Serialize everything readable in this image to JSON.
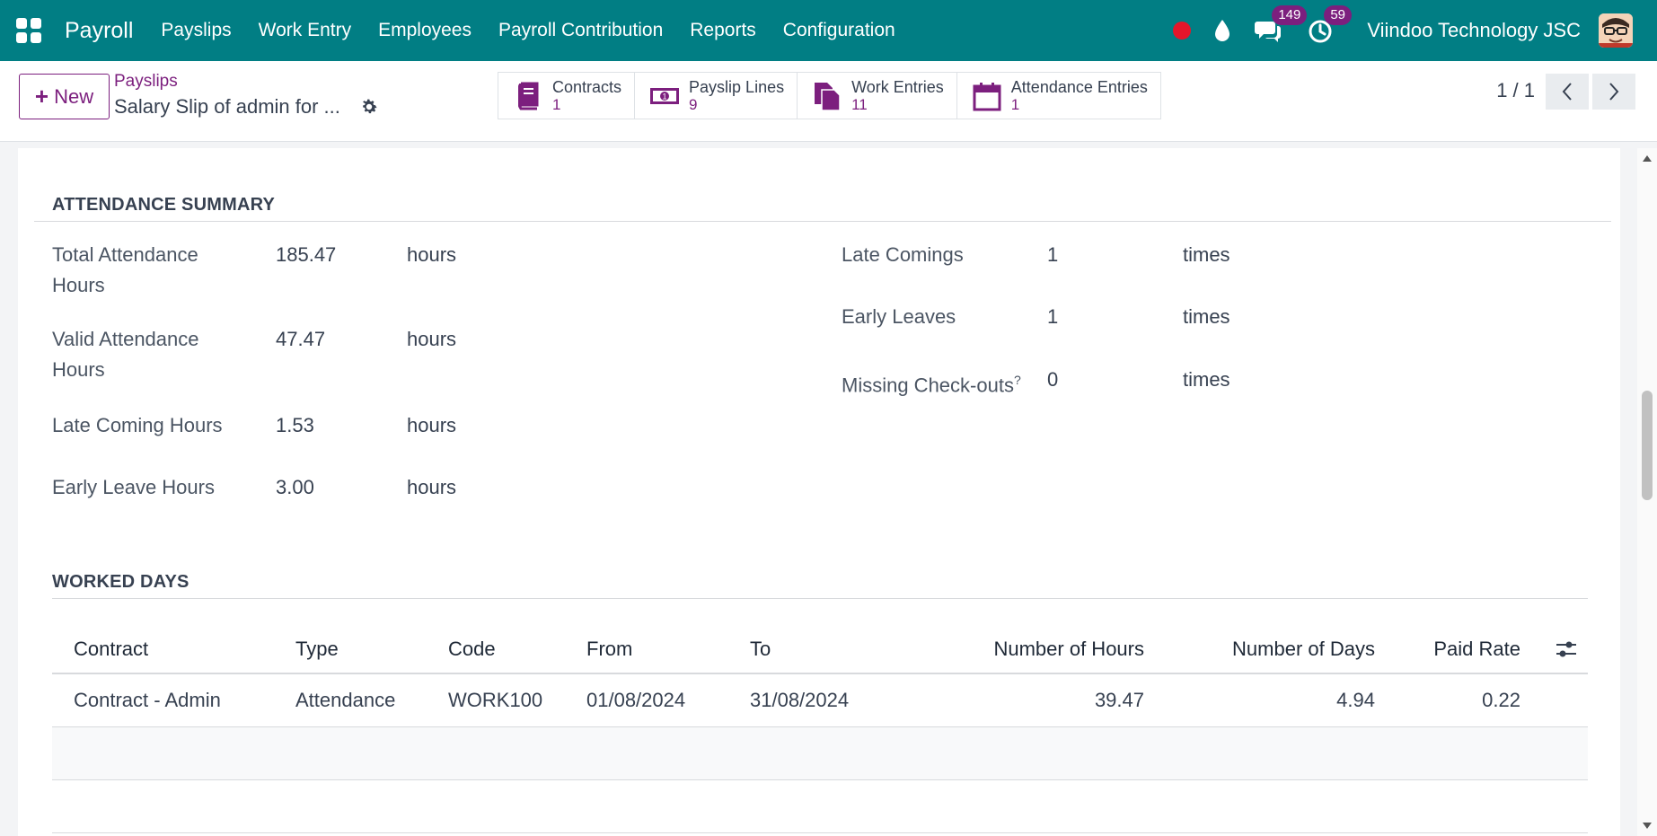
{
  "navbar": {
    "app_name": "Payroll",
    "menu": [
      "Payslips",
      "Work Entry",
      "Employees",
      "Payroll Contribution",
      "Reports",
      "Configuration"
    ],
    "messages_count": "149",
    "activities_count": "59",
    "company": "Viindoo Technology JSC",
    "colors": {
      "bar": "#017e84",
      "badge": "#7c1f7e",
      "recording": "#e4162a"
    }
  },
  "control": {
    "new_label": "New",
    "breadcrumb": "Payslips",
    "title": "Salary Slip of admin for ...",
    "smart_buttons": [
      {
        "label": "Contracts",
        "value": "1",
        "icon": "book-icon"
      },
      {
        "label": "Payslip Lines",
        "value": "9",
        "icon": "money-icon"
      },
      {
        "label": "Work Entries",
        "value": "11",
        "icon": "files-icon"
      },
      {
        "label": "Attendance Entries",
        "value": "1",
        "icon": "calendar-icon"
      }
    ],
    "pager": "1 / 1"
  },
  "attendance": {
    "section_title": "ATTENDANCE SUMMARY",
    "left": [
      {
        "label_1": "Total Attendance",
        "label_2": "Hours",
        "value": "185.47",
        "unit": "hours"
      },
      {
        "label_1": "Valid Attendance",
        "label_2": "Hours",
        "value": "47.47",
        "unit": "hours"
      },
      {
        "label_1": "Late Coming Hours",
        "label_2": "",
        "value": "1.53",
        "unit": "hours"
      },
      {
        "label_1": "Early Leave Hours",
        "label_2": "",
        "value": "3.00",
        "unit": "hours"
      }
    ],
    "right": [
      {
        "label": "Late Comings",
        "value": "1",
        "unit": "times"
      },
      {
        "label": "Early Leaves",
        "value": "1",
        "unit": "times"
      },
      {
        "label": "Missing Check-outs",
        "help": "?",
        "value": "0",
        "unit": "times"
      }
    ]
  },
  "worked_days": {
    "section_title": "WORKED DAYS",
    "columns": [
      "Contract",
      "Type",
      "Code",
      "From",
      "To",
      "Number of Hours",
      "Number of Days",
      "Paid Rate"
    ],
    "rows": [
      {
        "contract": "Contract - Admin",
        "type": "Attendance",
        "code": "WORK100",
        "from": "01/08/2024",
        "to": "31/08/2024",
        "hours": "39.47",
        "days": "4.94",
        "paid_rate": "0.22"
      }
    ]
  }
}
